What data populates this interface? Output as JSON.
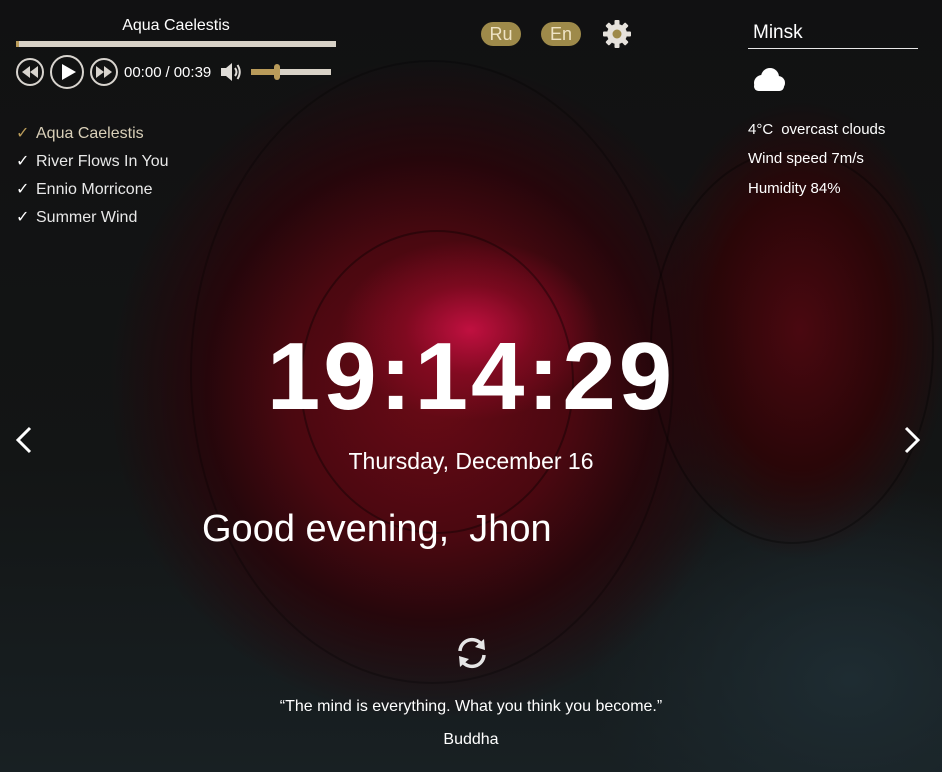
{
  "player": {
    "track_title": "Aqua Caelestis",
    "current_time": "00:00",
    "time_separator": "/",
    "duration": "00:39",
    "progress": 0.0,
    "volume": 0.32,
    "playlist": [
      {
        "title": "Aqua Caelestis",
        "active": true
      },
      {
        "title": "River Flows In You",
        "active": false
      },
      {
        "title": "Ennio Morricone",
        "active": false
      },
      {
        "title": "Summer Wind",
        "active": false
      }
    ]
  },
  "language": {
    "ru_label": "Ru",
    "en_label": "En"
  },
  "weather": {
    "city": "Minsk",
    "icon": "cloud-icon",
    "temperature": "4°C",
    "description": "overcast clouds",
    "wind": "Wind speed 7m/s",
    "humidity": "Humidity 84%"
  },
  "clock": {
    "time": "19:14:29",
    "date": "Thursday, December 16"
  },
  "greeting": {
    "text": "Good evening,",
    "name": "Jhon"
  },
  "quote": {
    "text": "“The mind is everything. What you think you become.”",
    "author": "Buddha"
  },
  "colors": {
    "accent": "#b99b5a",
    "lang_button_bg": "#9e8a4a",
    "track_bar": "#d8d2c7"
  }
}
